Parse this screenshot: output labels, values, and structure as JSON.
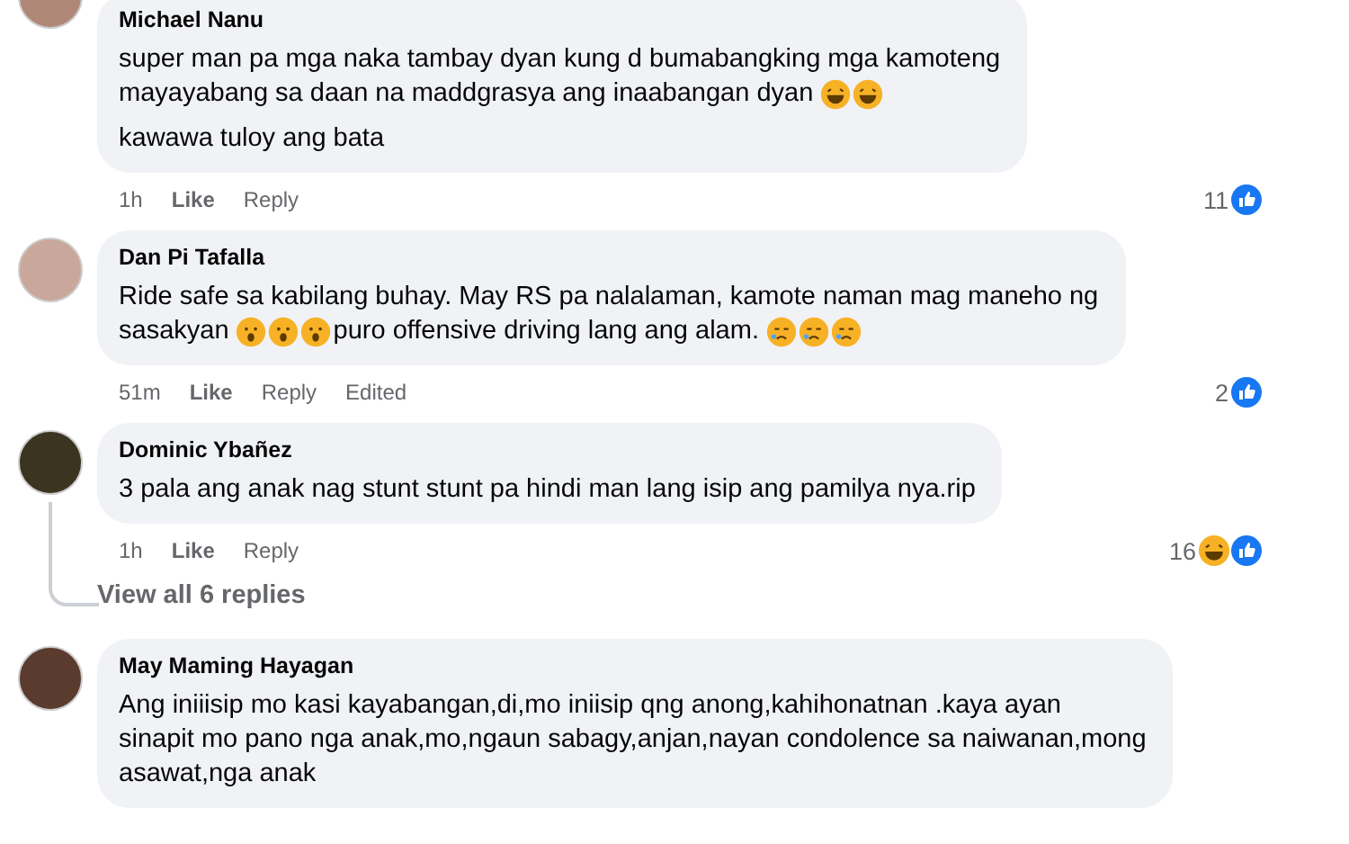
{
  "comments": [
    {
      "author": "Michael Nanu",
      "paragraphs": [
        [
          [
            {
              "kind": "text",
              "text": "super man pa mga naka tambay dyan kung d bumabangking mga kamoteng"
            }
          ],
          [
            {
              "kind": "text",
              "text": "mayayabang sa daan na maddgrasya ang inaabangan dyan"
            },
            {
              "kind": "laughing"
            },
            {
              "kind": "laughing"
            }
          ]
        ],
        [
          [
            {
              "kind": "text",
              "text": "kawawa tuloy ang bata"
            }
          ]
        ]
      ],
      "time": "1h",
      "actions": [
        "Like",
        "Reply"
      ],
      "reaction_count": "11",
      "reactions": [
        {
          "kind": "like"
        }
      ]
    },
    {
      "author": "Dan Pi Tafalla",
      "paragraphs": [
        [
          [
            {
              "kind": "text",
              "text": "Ride safe sa kabilang buhay. May RS pa nalalaman, kamote naman mag maneho ng"
            }
          ],
          [
            {
              "kind": "text",
              "text": "sasakyan"
            },
            {
              "kind": "shocked"
            },
            {
              "kind": "shocked"
            },
            {
              "kind": "shocked"
            },
            {
              "kind": "text",
              "text": "puro offensive driving lang ang alam."
            },
            {
              "kind": "crying"
            },
            {
              "kind": "crying"
            },
            {
              "kind": "crying"
            }
          ]
        ]
      ],
      "time": "51m",
      "actions": [
        "Like",
        "Reply",
        "Edited"
      ],
      "reaction_count": "2",
      "reactions": [
        {
          "kind": "like"
        }
      ]
    },
    {
      "author": "Dominic Ybañez",
      "paragraphs": [
        [
          [
            {
              "kind": "text",
              "text": "3 pala ang anak nag stunt stunt pa hindi man lang isip ang pamilya nya.rip"
            }
          ]
        ]
      ],
      "time": "1h",
      "actions": [
        "Like",
        "Reply"
      ],
      "reaction_count": "16",
      "reactions": [
        {
          "kind": "haha"
        },
        {
          "kind": "like"
        }
      ],
      "replies_link": "View all 6 replies"
    },
    {
      "author": "May Maming Hayagan",
      "paragraphs": [
        [
          [
            {
              "kind": "text",
              "text": "Ang iniiisip mo kasi kayabangan,di,mo iniisip qng anong,kahihonatnan .kaya ayan"
            }
          ],
          [
            {
              "kind": "text",
              "text": "sinapit mo pano nga anak,mo,ngaun sabagy,anjan,nayan condolence sa naiwanan,mong"
            }
          ],
          [
            {
              "kind": "text",
              "text": "asawat,nga anak"
            }
          ]
        ]
      ]
    }
  ]
}
